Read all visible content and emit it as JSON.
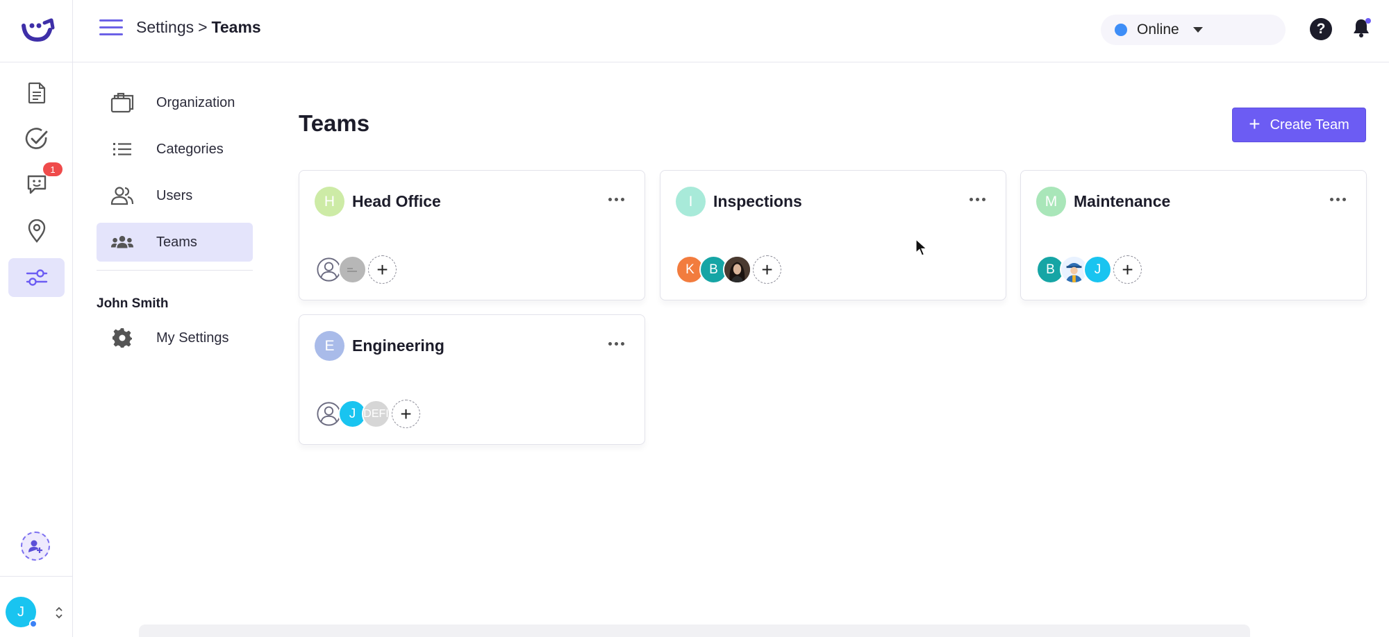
{
  "app": {
    "brand_color": "#6c5cf3",
    "accent_color": "#3e2fa8"
  },
  "rail": {
    "items": [
      {
        "name": "documents",
        "icon": "document-icon",
        "active": false
      },
      {
        "name": "tasks",
        "icon": "check-circle-icon",
        "active": false
      },
      {
        "name": "messages",
        "icon": "chat-face-icon",
        "active": false,
        "badge": "1"
      },
      {
        "name": "locations",
        "icon": "map-pin-icon",
        "active": false
      },
      {
        "name": "settings",
        "icon": "sliders-icon",
        "active": true
      }
    ],
    "user_initial": "J"
  },
  "topbar": {
    "breadcrumb_parent": "Settings",
    "breadcrumb_separator": ">",
    "breadcrumb_current": "Teams",
    "status_label": "Online",
    "status_color": "#3e8ef7",
    "help_label": "?"
  },
  "settings_nav": {
    "items": [
      {
        "label": "Organization",
        "icon": "briefcase-icon",
        "active": false
      },
      {
        "label": "Categories",
        "icon": "list-icon",
        "active": false
      },
      {
        "label": "Users",
        "icon": "users-icon",
        "active": false
      },
      {
        "label": "Teams",
        "icon": "team-icon",
        "active": true
      }
    ],
    "section_title": "John Smith",
    "section_items": [
      {
        "label": "My Settings",
        "icon": "gear-icon",
        "active": false
      }
    ]
  },
  "main": {
    "title": "Teams",
    "create_button_label": "Create Team",
    "create_button_icon": "+",
    "add_member_label": "+",
    "teams": [
      {
        "name": "Head Office",
        "initial": "H",
        "initial_color": "#cdeba6",
        "members": [
          {
            "type": "placeholder"
          },
          {
            "type": "image",
            "color": "#b7b7b7"
          }
        ]
      },
      {
        "name": "Inspections",
        "initial": "I",
        "initial_color": "#a8ead9",
        "members": [
          {
            "type": "initial",
            "label": "K",
            "color": "#f27c3e"
          },
          {
            "type": "initial",
            "label": "B",
            "color": "#16a5a5"
          },
          {
            "type": "photo",
            "color": "#3a2b24"
          }
        ]
      },
      {
        "name": "Maintenance",
        "initial": "M",
        "initial_color": "#a9e6b9",
        "members": [
          {
            "type": "initial",
            "label": "B",
            "color": "#16a5a5"
          },
          {
            "type": "worker",
            "color": "#e9f2ff"
          },
          {
            "type": "initial",
            "label": "J",
            "color": "#19c4f0"
          }
        ]
      },
      {
        "name": "Engineering",
        "initial": "E",
        "initial_color": "#a9bbe9",
        "members": [
          {
            "type": "placeholder"
          },
          {
            "type": "initial",
            "label": "J",
            "color": "#19c4f0"
          },
          {
            "type": "initial",
            "label": "DEFI",
            "color": "#d6d6d6"
          }
        ]
      }
    ]
  }
}
